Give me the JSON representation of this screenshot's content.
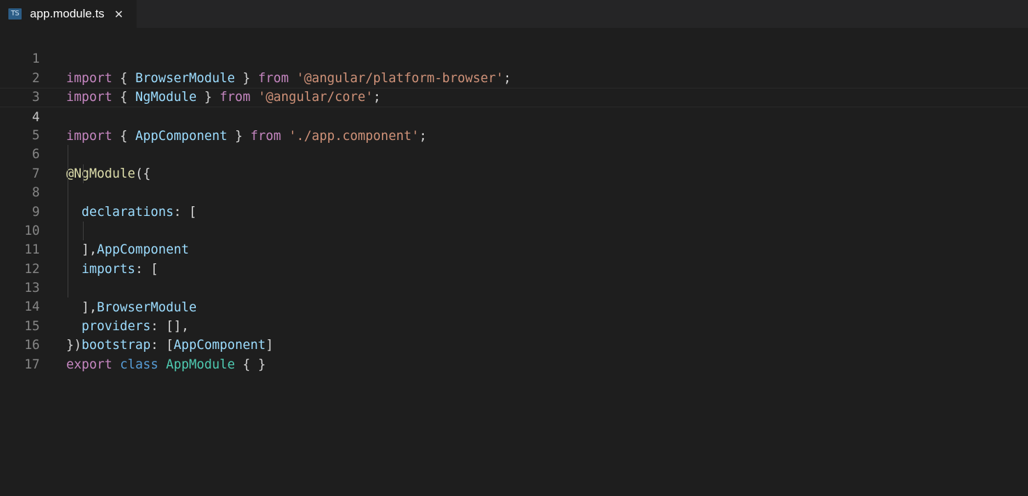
{
  "tab": {
    "icon_label": "TS",
    "title": "app.module.ts",
    "close_glyph": "✕"
  },
  "line_numbers": [
    "1",
    "2",
    "3",
    "4",
    "5",
    "6",
    "7",
    "8",
    "9",
    "10",
    "11",
    "12",
    "13",
    "14",
    "15",
    "16",
    "17"
  ],
  "code": {
    "import_kw": "import",
    "from_kw": "from",
    "export_kw": "export",
    "class_kw": "class",
    "browser_module": "BrowserModule",
    "ng_module": "NgModule",
    "app_component": "AppComponent",
    "app_module": "AppModule",
    "str_platform_browser": "'@angular/platform-browser'",
    "str_core": "'@angular/core'",
    "str_app_component": "'./app.component'",
    "decorator": "@NgModule",
    "declarations": "declarations",
    "imports": "imports",
    "providers": "providers",
    "bootstrap": "bootstrap"
  },
  "colors": {
    "background": "#1e1e1e",
    "keyword": "#c586c0",
    "storage": "#569cd6",
    "variable": "#9cdcfe",
    "string": "#ce9178",
    "function": "#dcdcaa",
    "type": "#4ec9b0",
    "line_number": "#858585"
  },
  "icons": {
    "tab_file_icon": "typescript-file-icon",
    "tab_close_icon": "close-icon"
  }
}
